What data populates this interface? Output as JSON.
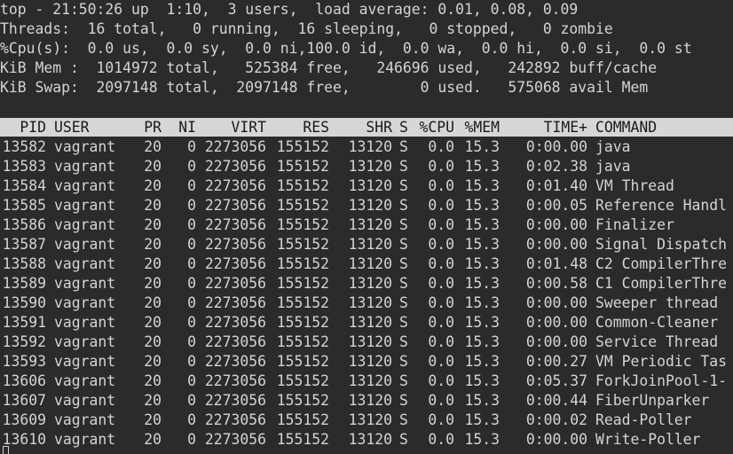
{
  "summary": [
    "top - 21:50:26 up  1:10,  3 users,  load average: 0.01, 0.08, 0.09",
    "Threads:  16 total,   0 running,  16 sleeping,   0 stopped,   0 zombie",
    "%Cpu(s):  0.0 us,  0.0 sy,  0.0 ni,100.0 id,  0.0 wa,  0.0 hi,  0.0 si,  0.0 st",
    "KiB Mem :  1014972 total,   525384 free,   246696 used,   242892 buff/cache",
    "KiB Swap:  2097148 total,  2097148 free,        0 used.   575068 avail Mem"
  ],
  "columns": [
    "PID",
    "USER",
    "PR",
    "NI",
    "VIRT",
    "RES",
    "SHR",
    "S",
    "%CPU",
    "%MEM",
    "TIME+",
    "COMMAND"
  ],
  "processes": [
    [
      "13582",
      "vagrant",
      "20",
      "0",
      "2273056",
      "155152",
      "13120",
      "S",
      "0.0",
      "15.3",
      "0:00.00",
      "java"
    ],
    [
      "13583",
      "vagrant",
      "20",
      "0",
      "2273056",
      "155152",
      "13120",
      "S",
      "0.0",
      "15.3",
      "0:02.38",
      "java"
    ],
    [
      "13584",
      "vagrant",
      "20",
      "0",
      "2273056",
      "155152",
      "13120",
      "S",
      "0.0",
      "15.3",
      "0:01.40",
      "VM Thread"
    ],
    [
      "13585",
      "vagrant",
      "20",
      "0",
      "2273056",
      "155152",
      "13120",
      "S",
      "0.0",
      "15.3",
      "0:00.05",
      "Reference Handl"
    ],
    [
      "13586",
      "vagrant",
      "20",
      "0",
      "2273056",
      "155152",
      "13120",
      "S",
      "0.0",
      "15.3",
      "0:00.00",
      "Finalizer"
    ],
    [
      "13587",
      "vagrant",
      "20",
      "0",
      "2273056",
      "155152",
      "13120",
      "S",
      "0.0",
      "15.3",
      "0:00.00",
      "Signal Dispatch"
    ],
    [
      "13588",
      "vagrant",
      "20",
      "0",
      "2273056",
      "155152",
      "13120",
      "S",
      "0.0",
      "15.3",
      "0:01.48",
      "C2 CompilerThre"
    ],
    [
      "13589",
      "vagrant",
      "20",
      "0",
      "2273056",
      "155152",
      "13120",
      "S",
      "0.0",
      "15.3",
      "0:00.58",
      "C1 CompilerThre"
    ],
    [
      "13590",
      "vagrant",
      "20",
      "0",
      "2273056",
      "155152",
      "13120",
      "S",
      "0.0",
      "15.3",
      "0:00.00",
      "Sweeper thread"
    ],
    [
      "13591",
      "vagrant",
      "20",
      "0",
      "2273056",
      "155152",
      "13120",
      "S",
      "0.0",
      "15.3",
      "0:00.00",
      "Common-Cleaner"
    ],
    [
      "13592",
      "vagrant",
      "20",
      "0",
      "2273056",
      "155152",
      "13120",
      "S",
      "0.0",
      "15.3",
      "0:00.00",
      "Service Thread"
    ],
    [
      "13593",
      "vagrant",
      "20",
      "0",
      "2273056",
      "155152",
      "13120",
      "S",
      "0.0",
      "15.3",
      "0:00.27",
      "VM Periodic Tas"
    ],
    [
      "13606",
      "vagrant",
      "20",
      "0",
      "2273056",
      "155152",
      "13120",
      "S",
      "0.0",
      "15.3",
      "0:05.37",
      "ForkJoinPool-1-"
    ],
    [
      "13607",
      "vagrant",
      "20",
      "0",
      "2273056",
      "155152",
      "13120",
      "S",
      "0.0",
      "15.3",
      "0:00.44",
      "FiberUnparker"
    ],
    [
      "13609",
      "vagrant",
      "20",
      "0",
      "2273056",
      "155152",
      "13120",
      "S",
      "0.0",
      "15.3",
      "0:00.02",
      "Read-Poller"
    ],
    [
      "13610",
      "vagrant",
      "20",
      "0",
      "2273056",
      "155152",
      "13120",
      "S",
      "0.0",
      "15.3",
      "0:00.00",
      "Write-Poller"
    ]
  ]
}
